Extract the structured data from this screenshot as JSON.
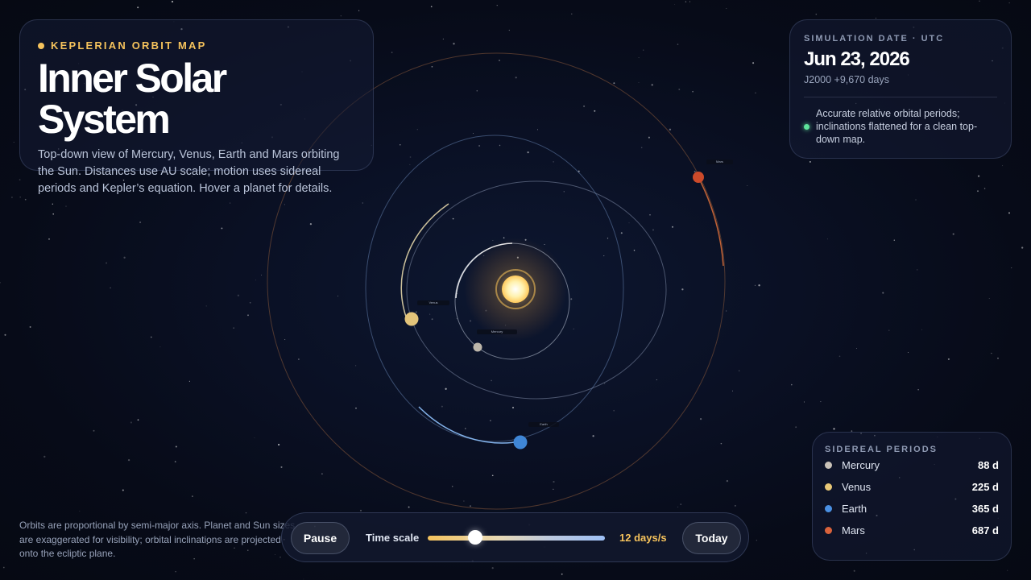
{
  "header": {
    "eyebrow": "KEPLERIAN ORBIT MAP",
    "title": "Inner Solar System",
    "description": "Top-down view of Mercury, Venus, Earth and Mars orbiting the Sun. Distances use AU scale; motion uses sidereal periods and Kepler’s equation. Hover a planet for details."
  },
  "simulation": {
    "label": "SIMULATION DATE · UTC",
    "date": "Jun 23, 2026",
    "epoch": "J2000 +9,670 days",
    "note": "Accurate relative orbital periods; inclinations flattened for a clean top-down map."
  },
  "periods": {
    "label": "SIDEREAL PERIODS",
    "items": [
      {
        "name": "Mercury",
        "value": "88 d",
        "color": "#c9c2b8"
      },
      {
        "name": "Venus",
        "value": "225 d",
        "color": "#e8c877"
      },
      {
        "name": "Earth",
        "value": "365 d",
        "color": "#4a90e2"
      },
      {
        "name": "Mars",
        "value": "687 d",
        "color": "#d9623b"
      }
    ]
  },
  "footnote": "Orbits are proportional by semi-major axis. Planet and Sun sizes are exaggerated for visibility; orbital inclinations are projected onto the ecliptic plane.",
  "controls": {
    "pause_label": "Pause",
    "time_scale_label": "Time scale",
    "time_scale_value": "12 days/s",
    "time_scale_fraction": 0.27,
    "today_label": "Today"
  },
  "planets": [
    {
      "name": "Mercury",
      "color": "#bdb6aa"
    },
    {
      "name": "Venus",
      "color": "#e3c47a"
    },
    {
      "name": "Earth",
      "color": "#3f86d6"
    },
    {
      "name": "Mars",
      "color": "#cc4a2a"
    }
  ],
  "colors": {
    "accent": "#f6c35c",
    "sun": "#fff3b0",
    "status_dot": "#5ee39b"
  }
}
